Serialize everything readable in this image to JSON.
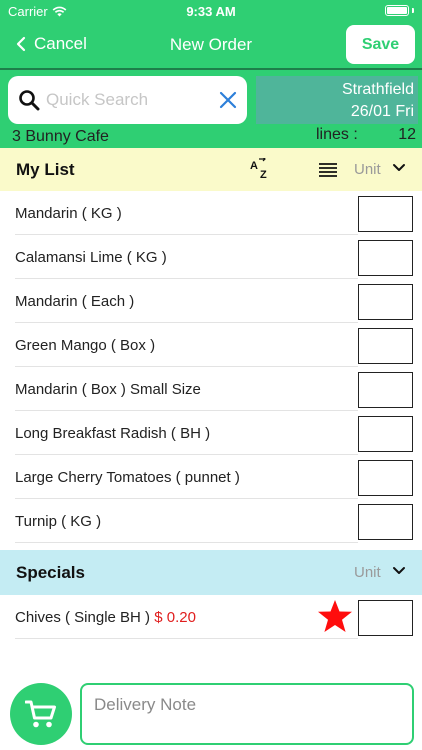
{
  "status_bar": {
    "carrier": "Carrier",
    "time": "9:33 AM"
  },
  "nav": {
    "cancel_label": "Cancel",
    "title": "New Order",
    "save_label": "Save"
  },
  "search": {
    "placeholder": "Quick Search"
  },
  "location": {
    "suburb": "Strathfield",
    "date": "26/01 Fri"
  },
  "customer": {
    "name": "3 Bunny Cafe"
  },
  "lines": {
    "label": "lines :",
    "count": "12"
  },
  "my_list": {
    "title": "My List",
    "unit_label": "Unit",
    "items": [
      {
        "name": "Mandarin ( KG )"
      },
      {
        "name": "Calamansi Lime ( KG )"
      },
      {
        "name": "Mandarin ( Each )"
      },
      {
        "name": "Green Mango ( Box )"
      },
      {
        "name": "Mandarin ( Box ) Small Size"
      },
      {
        "name": "Long Breakfast Radish ( BH )"
      },
      {
        "name": "Large Cherry Tomatoes ( punnet )"
      },
      {
        "name": "Turnip ( KG )"
      }
    ]
  },
  "specials": {
    "title": "Specials",
    "unit_label": "Unit",
    "items": [
      {
        "name": "Chives ( Single BH )",
        "price": "$ 0.20"
      }
    ]
  },
  "delivery_note": {
    "placeholder": "Delivery Note"
  },
  "colors": {
    "brand_green": "#2fcf73",
    "list_header": "#fafaca",
    "specials_header": "#c4ecf3",
    "price_red": "#e01e1e",
    "location_bg": "#4fb59a"
  },
  "icons": [
    "wifi-icon",
    "battery-icon",
    "back-chevron-icon",
    "search-icon",
    "clear-icon",
    "sort-az-icon",
    "list-icon",
    "chevron-down-icon",
    "star-icon",
    "cart-icon"
  ]
}
